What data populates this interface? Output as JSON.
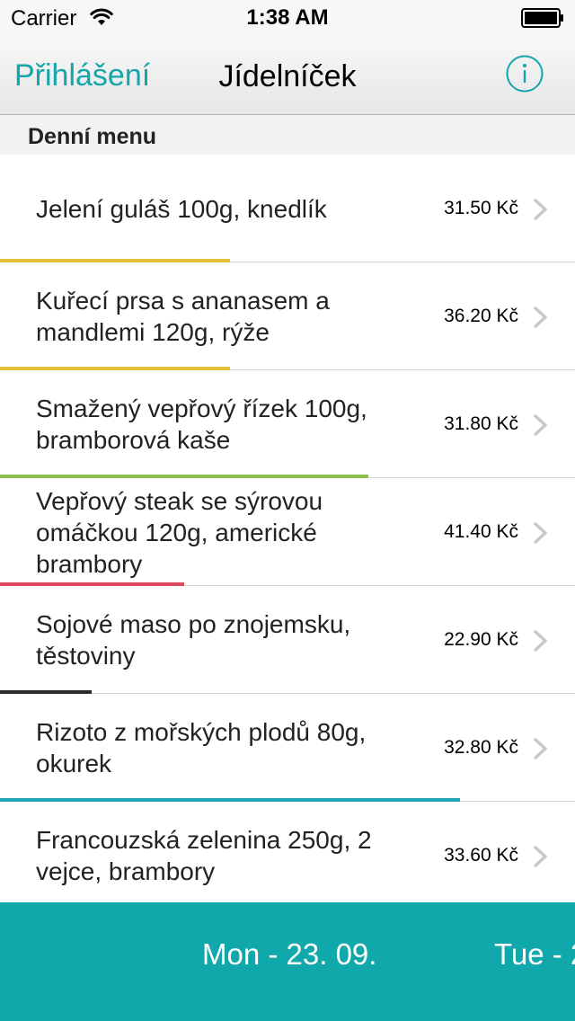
{
  "status_bar": {
    "carrier": "Carrier",
    "time": "1:38 AM"
  },
  "nav": {
    "left_button": "Přihlášení",
    "title": "Jídelníček",
    "info_icon": "info-icon",
    "accent_color": "#14a6aa"
  },
  "section": {
    "header": "Denní menu"
  },
  "menu": {
    "items": [
      {
        "name_lines": [
          "Jelení guláš 100g, knedlík"
        ],
        "price": "31.50 Kč",
        "bar_color": "#e3c13d",
        "bar_fraction": 0.4
      },
      {
        "name_lines": [
          "Kuřecí prsa s ananasem a",
          "mandlemi 120g, rýže"
        ],
        "price": "36.20 Kč",
        "bar_color": "#e3c13d",
        "bar_fraction": 0.4
      },
      {
        "name_lines": [
          "Smažený vepřový řízek 100g,",
          "bramborová kaše"
        ],
        "price": "31.80 Kč",
        "bar_color": "#8cc152",
        "bar_fraction": 0.64
      },
      {
        "name_lines": [
          "Vepřový steak se sýrovou",
          "omáčkou 120g, americké",
          "brambory"
        ],
        "price": "41.40 Kč",
        "bar_color": "#da4a5c",
        "bar_fraction": 0.32
      },
      {
        "name_lines": [
          "Sojové maso po znojemsku,",
          "těstoviny"
        ],
        "price": "22.90 Kč",
        "bar_color": "#2b2b2b",
        "bar_fraction": 0.16
      },
      {
        "name_lines": [
          "Rizoto z mořských plodů 80g,",
          "okurek"
        ],
        "price": "32.80 Kč",
        "bar_color": "#1fa6b2",
        "bar_fraction": 0.8
      },
      {
        "name_lines": [
          "Francouzská zelenina 250g, 2",
          "vejce, brambory"
        ],
        "price": "33.60 Kč",
        "bar_color": "",
        "bar_fraction": 0
      }
    ]
  },
  "day_pager": {
    "current": "Mon - 23. 09.",
    "next": "Tue - 2",
    "background_color": "#11a8ac"
  }
}
